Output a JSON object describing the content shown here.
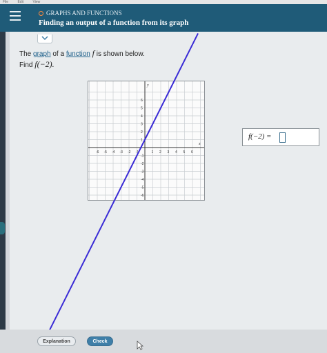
{
  "menubar": {
    "items": [
      "File",
      "Edit",
      "View"
    ]
  },
  "header": {
    "topic": "GRAPHS AND FUNCTIONS",
    "title": "Finding an output of a function from its graph",
    "accent_color": "#ff8a3d",
    "bar_color": "#1f5b78"
  },
  "problem": {
    "text_the": "The ",
    "link_graph": "graph",
    "text_of_a": " of a ",
    "link_function": "function",
    "func_symbol": "f",
    "text_shown": " is shown below.",
    "find_label": "Find ",
    "find_expr": "f(−2)."
  },
  "graph": {
    "x_ticks": [
      "-6",
      "-5",
      "-4",
      "-3",
      "-2",
      "-1",
      "1",
      "2",
      "3",
      "4",
      "5",
      "6"
    ],
    "y_ticks": [
      "6",
      "5",
      "4",
      "3",
      "2",
      "1",
      "-1",
      "-2",
      "-3",
      "-4",
      "-5",
      "-6"
    ],
    "x_label": "x",
    "y_label": "y",
    "x_range": [
      -7,
      7
    ],
    "y_range": [
      -7,
      7
    ],
    "line_slope": 2,
    "line_intercept": 1,
    "line_color": "#3a2bd6"
  },
  "answer": {
    "label": "f(−2) =",
    "value": ""
  },
  "footer": {
    "explanation": "Explanation",
    "check": "Check"
  }
}
